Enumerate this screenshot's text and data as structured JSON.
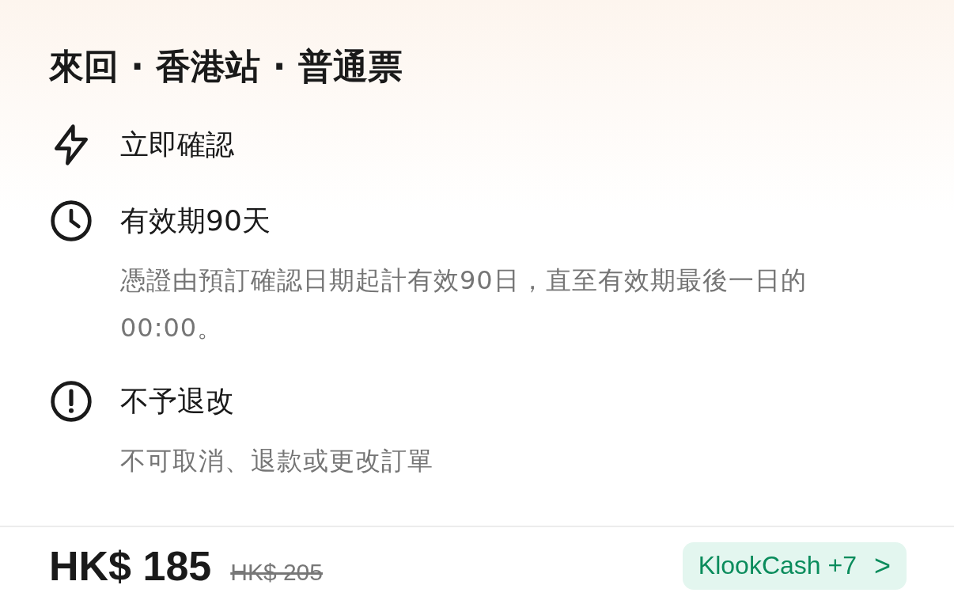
{
  "title": "來回 · 香港站 · 普通票",
  "features": [
    {
      "kind": "lightning",
      "title": "立即確認"
    },
    {
      "kind": "clock",
      "title": "有效期90天",
      "description": "憑證由預訂確認日期起計有效90日，直至有效期最後一日的00:00。"
    },
    {
      "kind": "alert",
      "title": "不予退改",
      "description": "不可取消、退款或更改訂單"
    }
  ],
  "price": {
    "current": "HK$ 185",
    "original": "HK$ 205"
  },
  "cash_button": {
    "label": "KlookCash +7",
    "icon": ">"
  }
}
